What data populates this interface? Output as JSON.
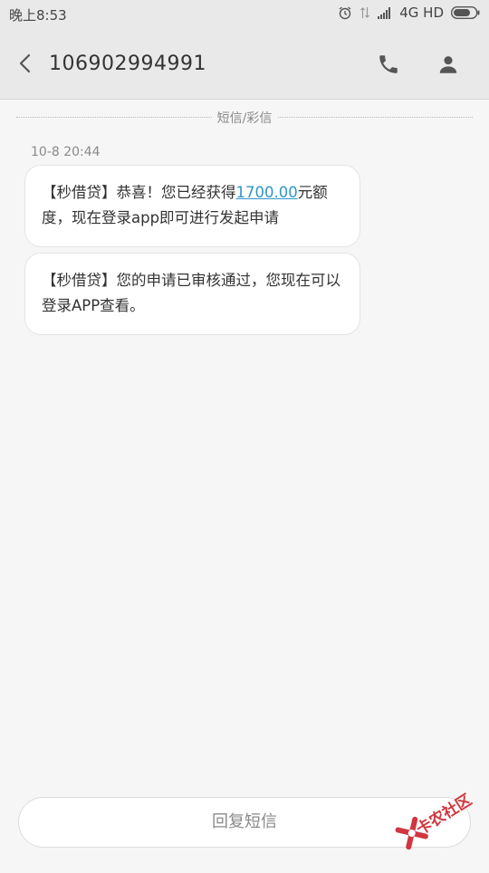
{
  "status_bar": {
    "time": "晚上8:53",
    "network": "4G HD",
    "icons": [
      "alarm-icon",
      "data-arrows-icon",
      "signal-icon",
      "battery-icon"
    ]
  },
  "header": {
    "contact_number": "106902994991",
    "icons": [
      "back-arrow-icon",
      "phone-icon",
      "person-icon"
    ]
  },
  "divider_label": "短信/彩信",
  "message_time": "10-8 20:44",
  "messages": [
    {
      "prefix": "【秒借贷】恭喜！您已经获得",
      "amount": "1700.00",
      "suffix": "元额度，现在登录app即可进行发起申请"
    },
    {
      "text": "【秒借贷】您的申请已审核通过，您现在可以登录APP查看。"
    }
  ],
  "reply_placeholder": "回复短信",
  "watermark": "卡农社区",
  "colors": {
    "link": "#2e96c8",
    "background": "#f6f6f6",
    "header": "#e9e9e9",
    "watermark": "#d0373f"
  }
}
